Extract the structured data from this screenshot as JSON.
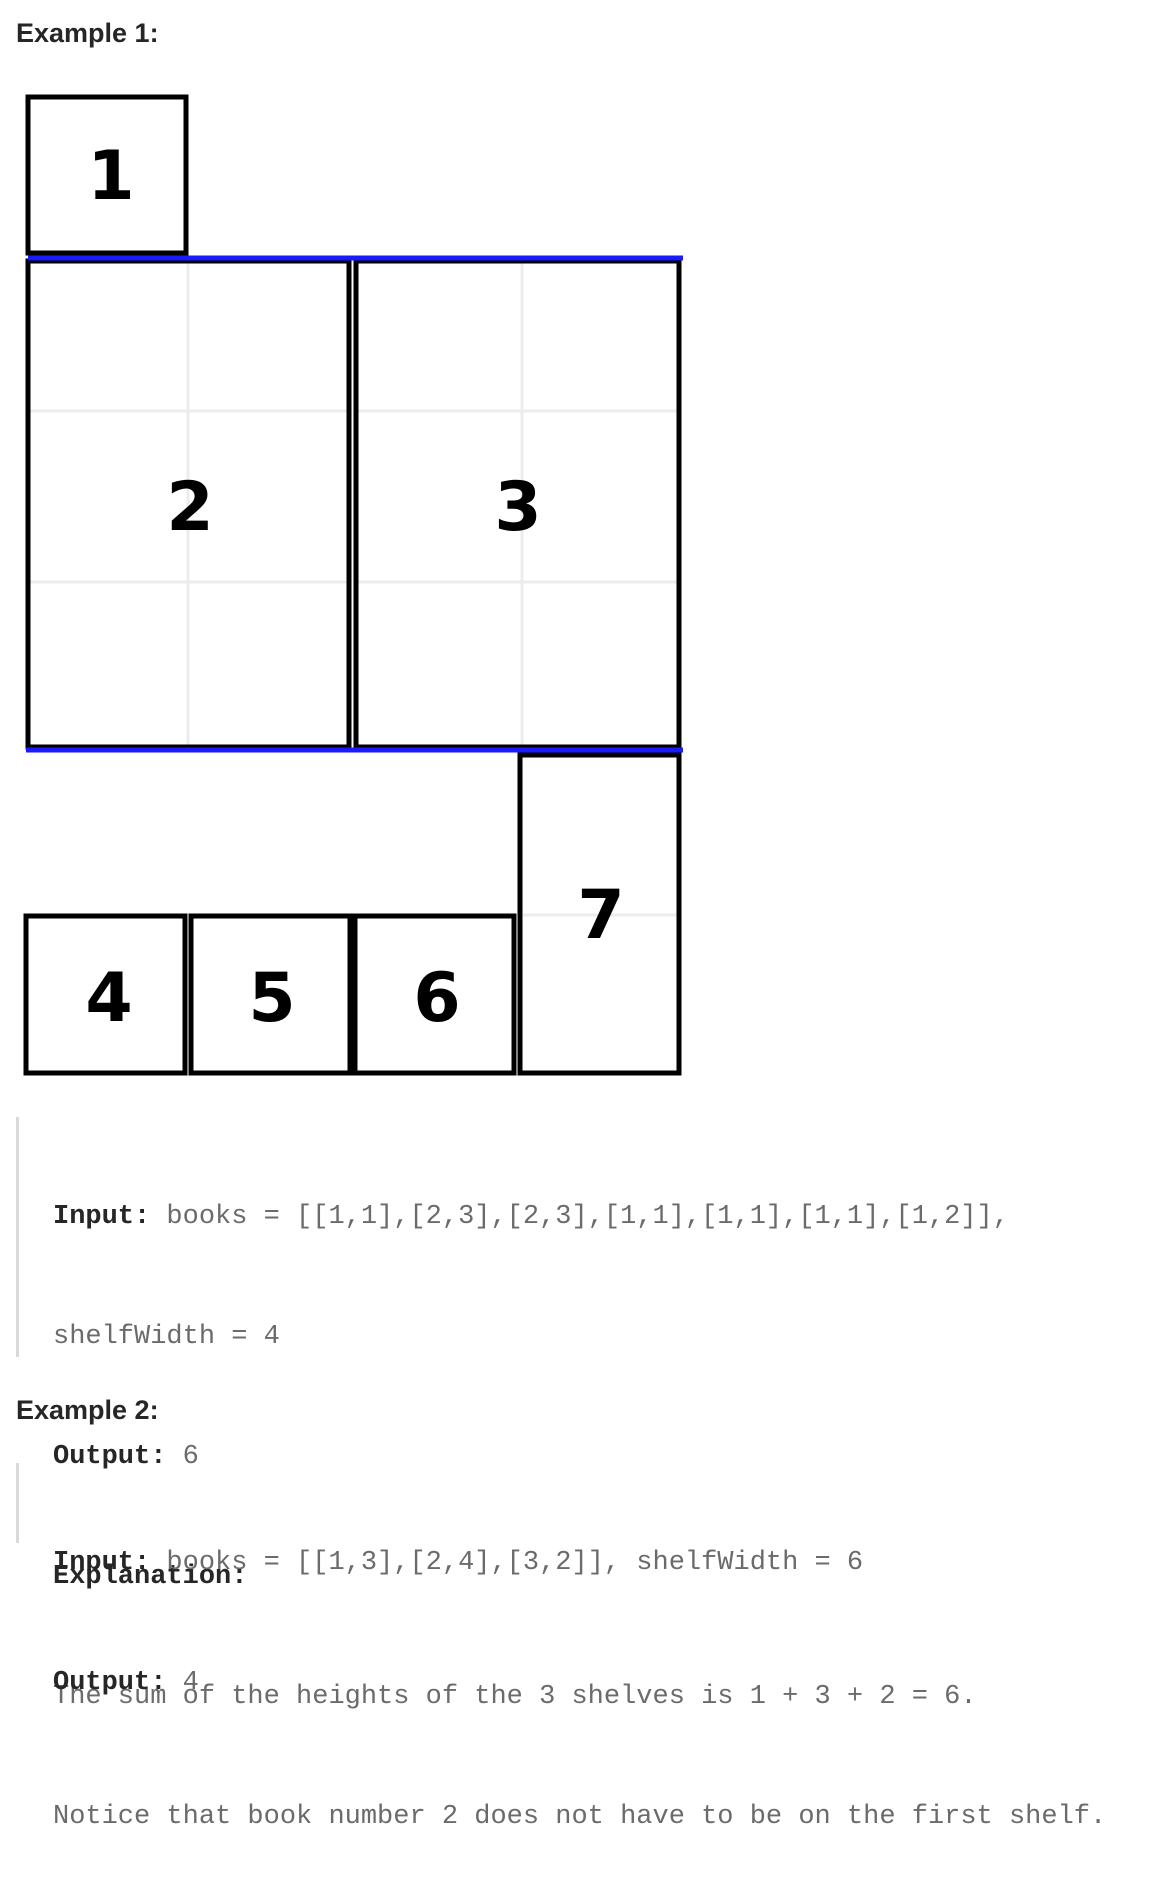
{
  "example1": {
    "heading": "Example 1:",
    "books": [
      {
        "label": "1"
      },
      {
        "label": "2"
      },
      {
        "label": "3"
      },
      {
        "label": "4"
      },
      {
        "label": "5"
      },
      {
        "label": "6"
      },
      {
        "label": "7"
      }
    ],
    "input_label": "Input:",
    "input_value_line1": " books = [[1,1],[2,3],[2,3],[1,1],[1,1],[1,1],[1,2]],",
    "input_value_line2": "shelfWidth = 4",
    "output_label": "Output:",
    "output_value": " 6",
    "explanation_label": "Explanation:",
    "explanation_line1": "The sum of the heights of the 3 shelves is 1 + 3 + 2 = 6.",
    "explanation_line2": "Notice that book number 2 does not have to be on the first shelf."
  },
  "example2": {
    "heading": "Example 2:",
    "input_label": "Input:",
    "input_value": " books = [[1,3],[2,4],[3,2]], shelfWidth = 6",
    "output_label": "Output:",
    "output_value": " 4"
  },
  "colors": {
    "shelf_line": "#1a1aff",
    "book_border": "#000000",
    "grid": "#ececec"
  }
}
